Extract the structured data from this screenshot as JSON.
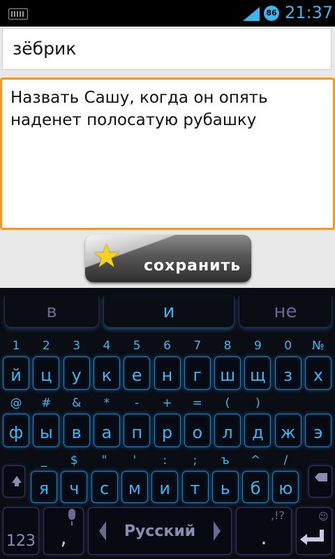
{
  "status": {
    "time": "21:37",
    "badge": "86"
  },
  "name_field": {
    "value": "зёбрик"
  },
  "note_field": {
    "value": "Назвать Сашу, когда он опять наденет полосатую рубашку"
  },
  "save_button": {
    "label": "сохранить"
  },
  "suggestions": [
    "в",
    "и",
    "не"
  ],
  "row_numbers": {
    "top": [
      "1",
      "2",
      "3",
      "4",
      "5",
      "6",
      "7",
      "8",
      "9",
      "0",
      "№"
    ],
    "main": [
      "й",
      "ц",
      "у",
      "к",
      "е",
      "н",
      "г",
      "ш",
      "щ",
      "з",
      "х"
    ]
  },
  "row_a": {
    "top": [
      "@",
      "#",
      "&",
      "*",
      "-",
      "+",
      "=",
      "(",
      ")",
      "",
      ""
    ],
    "main": [
      "ф",
      "ы",
      "в",
      "а",
      "п",
      "р",
      "о",
      "л",
      "д",
      "ж",
      "э"
    ]
  },
  "row_b": {
    "top": [
      "_",
      "$",
      "\"",
      "'",
      ":",
      ";",
      "ъ",
      "^",
      "/"
    ],
    "main": [
      "я",
      "ч",
      "с",
      "м",
      "и",
      "т",
      "ь",
      "б",
      "ю"
    ]
  },
  "bottom": {
    "num_key": "123",
    "comma": ",",
    "language": "Русский",
    "period": ".",
    "punct_top": ",!?",
    "smile": "☺"
  }
}
